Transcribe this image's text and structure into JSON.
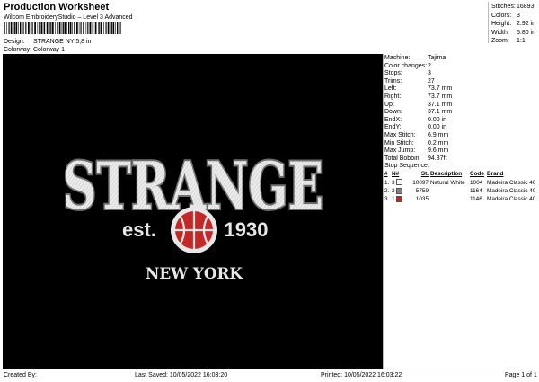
{
  "header": {
    "title": "Production Worksheet",
    "software": "Wilcom EmbroideryStudio – Level 3 Advanced",
    "design_label": "Design:",
    "design_value": "STRANGE NY 5,8 in",
    "colorway_label": "Colorway:",
    "colorway_value": "Colorway 1"
  },
  "top_stats": [
    {
      "label": "Stitches:",
      "value": "16893"
    },
    {
      "label": "Colors:",
      "value": "3"
    },
    {
      "label": "Height:",
      "value": "2.92 in"
    },
    {
      "label": "Width:",
      "value": "5.80 in"
    },
    {
      "label": "Zoom:",
      "value": "1:1"
    }
  ],
  "machine_info": [
    {
      "label": "Machine:",
      "value": "Tajima"
    },
    {
      "label": "Color changes:",
      "value": "2"
    },
    {
      "label": "Stops:",
      "value": "3"
    },
    {
      "label": "Trims:",
      "value": "27"
    },
    {
      "label": "Left:",
      "value": "73.7 mm"
    },
    {
      "label": "Right:",
      "value": "73.7 mm"
    },
    {
      "label": "Up:",
      "value": "37.1 mm"
    },
    {
      "label": "Down:",
      "value": "37.1 mm"
    },
    {
      "label": "EndX:",
      "value": "0.00 in"
    },
    {
      "label": "EndY:",
      "value": "0.00 in"
    },
    {
      "label": "Max Stitch:",
      "value": "6.9 mm"
    },
    {
      "label": "Min Stitch:",
      "value": "0.2 mm"
    },
    {
      "label": "Max Jump:",
      "value": "9.6 mm"
    },
    {
      "label": "Total Bobbin:",
      "value": "94.37ft"
    }
  ],
  "stop_sequence": {
    "title": "Stop Sequence:",
    "headers": [
      "#",
      "N#",
      "St.",
      "Description",
      "Code",
      "Brand"
    ],
    "rows": [
      {
        "idx": "1.",
        "n": "3",
        "color": "#ffffff",
        "st": "10097",
        "desc": "Natural White",
        "code": "1004",
        "brand": "Madeira Classic 40"
      },
      {
        "idx": "2.",
        "n": "2",
        "color": "#808080",
        "st": "5759",
        "desc": "",
        "code": "1164",
        "brand": "Madeira Classic 40"
      },
      {
        "idx": "3.",
        "n": "1",
        "color": "#cc2222",
        "st": "1035",
        "desc": "",
        "code": "1146",
        "brand": "Madeira Classic 40"
      }
    ]
  },
  "design_art": {
    "main_text": "STRANGE",
    "left_text": "est.",
    "right_text": "1930",
    "bottom_text": "NEW YORK",
    "background": "#000000",
    "fill_white": "#e8e8e8",
    "fill_gray": "#6e6e6e",
    "accent_red": "#c62828"
  },
  "footer": {
    "created": "Created By:",
    "saved": "Last Saved: 10/05/2022 16:03:20",
    "printed": "Printed: 10/05/2022 16:03:22",
    "page": "Page 1 of 1"
  }
}
